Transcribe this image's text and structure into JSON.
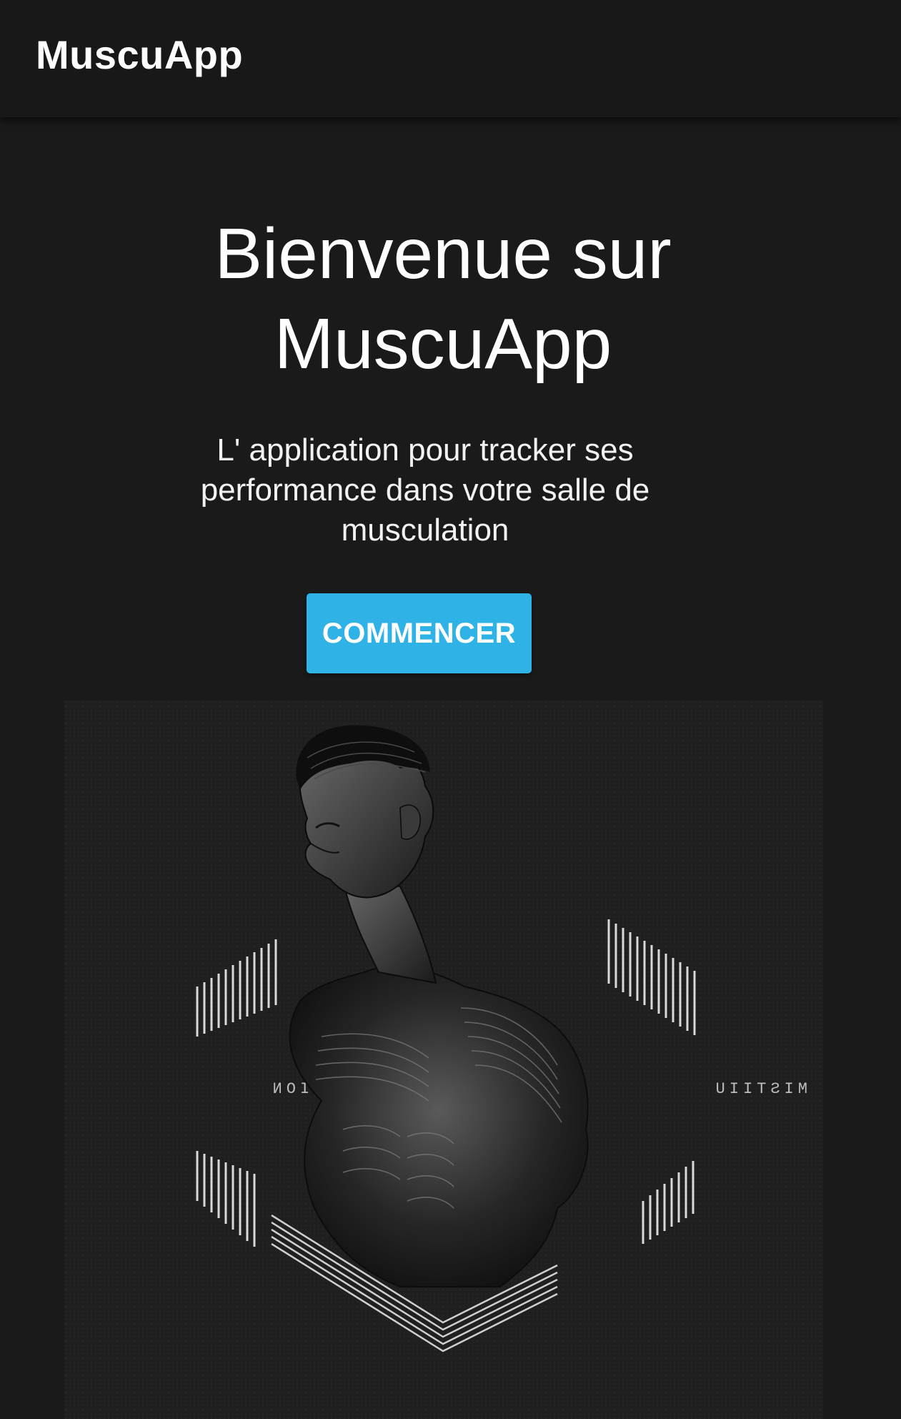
{
  "app_bar": {
    "title": "MuscuApp"
  },
  "hero": {
    "title_line1": "Bienvenue sur",
    "title_line2": "MuscuApp",
    "subtitle_line1": "L' application pour tracker ses",
    "subtitle_line2": "performance dans votre salle de",
    "subtitle_line3": "musculation",
    "cta_label": "COMMENCER"
  },
  "illustration": {
    "left_label": "MALLION",
    "right_label": "MISTIIU",
    "icon": "muscular-man-illustration"
  },
  "colors": {
    "background": "#1a1a1a",
    "app_bar": "#181818",
    "accent": "#2fb3e6",
    "text": "#ffffff"
  }
}
